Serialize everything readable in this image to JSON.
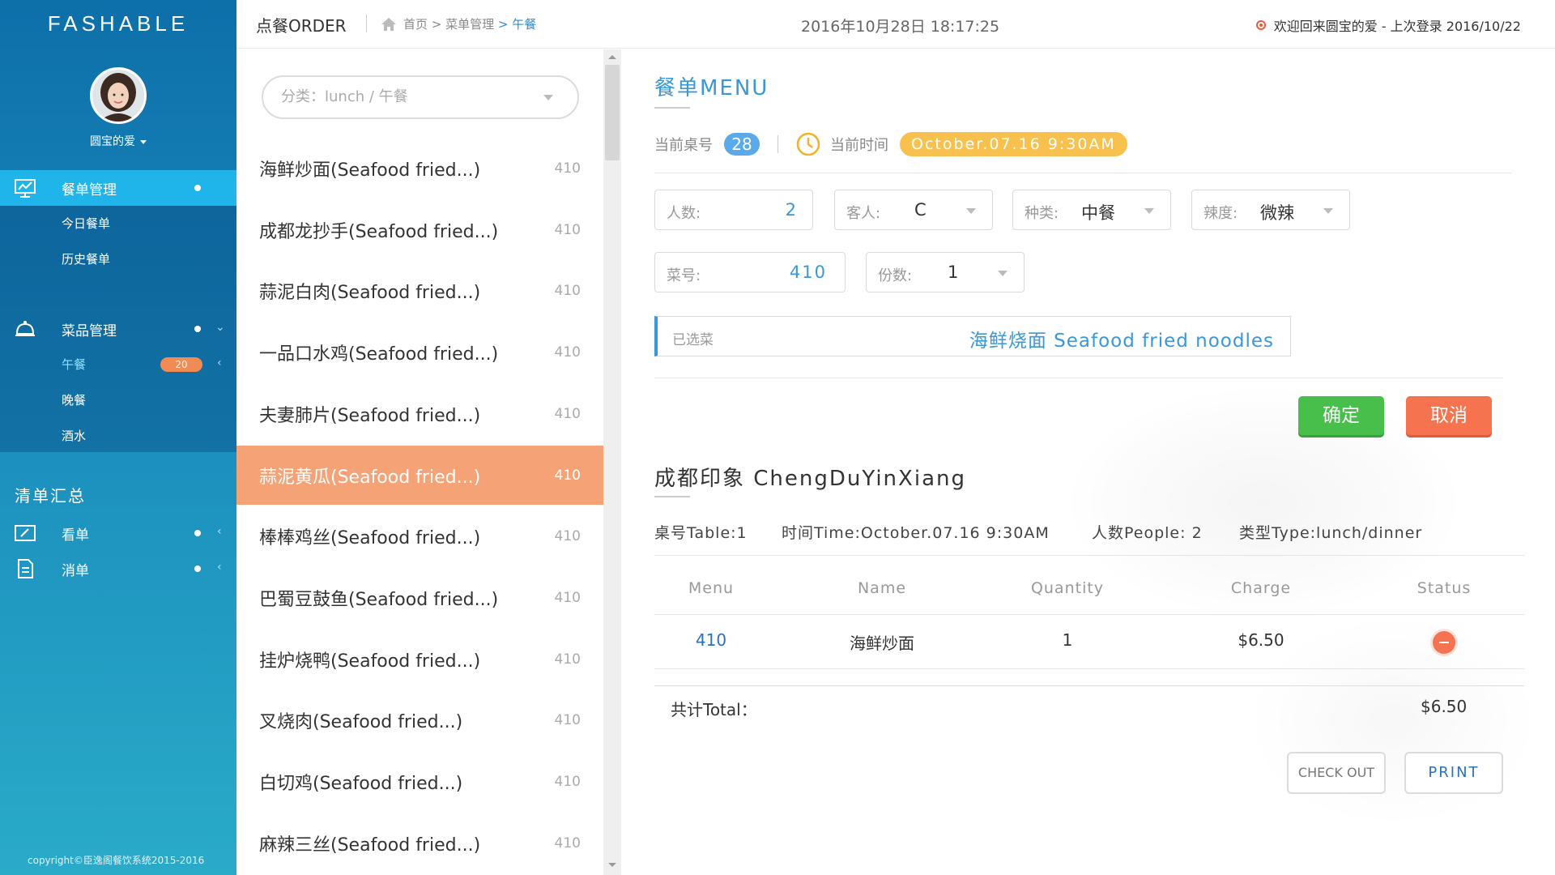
{
  "sidebar": {
    "brand": "FASHABLE",
    "user_name": "圆宝的爱",
    "groups": [
      {
        "label": "餐单管理",
        "icon": "chart-monitor-icon",
        "items": [
          "今日餐单",
          "历史餐单"
        ]
      },
      {
        "label": "菜品管理",
        "icon": "food-cloche-icon",
        "items": [
          "午餐",
          "晚餐",
          "酒水"
        ],
        "badge": "20"
      }
    ],
    "section_title": "清单汇总",
    "section_items": [
      {
        "label": "看单",
        "icon": "edit-screen-icon"
      },
      {
        "label": "消单",
        "icon": "document-icon"
      }
    ],
    "copyright": "copyright©臣逸阁餐饮系统2015-2016"
  },
  "topbar": {
    "title": "点餐ORDER",
    "breadcrumb": [
      "首页",
      "菜单管理",
      "午餐"
    ],
    "datetime": "2016年10月28日 18:17:25",
    "welcome": "欢迎回来圆宝的爱 - 上次登录 2016/10/22"
  },
  "dish_list": {
    "category_placeholder": "分类：lunch / 午餐",
    "items": [
      {
        "name": "海鲜炒面(Seafood  fried...)",
        "code": "410"
      },
      {
        "name": "成都龙抄手(Seafood  fried...)",
        "code": "410"
      },
      {
        "name": "蒜泥白肉(Seafood  fried...)",
        "code": "410"
      },
      {
        "name": "一品口水鸡(Seafood  fried...)",
        "code": "410"
      },
      {
        "name": "夫妻肺片(Seafood  fried...)",
        "code": "410"
      },
      {
        "name": "蒜泥黄瓜(Seafood  fried...)",
        "code": "410"
      },
      {
        "name": "棒棒鸡丝(Seafood  fried...)",
        "code": "410"
      },
      {
        "name": "巴蜀豆鼓鱼(Seafood  fried...)",
        "code": "410"
      },
      {
        "name": "挂炉烧鸭(Seafood  fried...)",
        "code": "410"
      },
      {
        "name": "叉烧肉(Seafood  fried...)",
        "code": "410"
      },
      {
        "name": "白切鸡(Seafood  fried...)",
        "code": "410"
      },
      {
        "name": "麻辣三丝(Seafood  fried...)",
        "code": "410"
      }
    ],
    "selected_index": 5
  },
  "order": {
    "title": "餐单MENU",
    "table_label": "当前桌号",
    "table_no": "28",
    "time_label": "当前时间",
    "time_value": "October.07.16   9:30AM",
    "fields": {
      "people": {
        "label": "人数:",
        "value": "2"
      },
      "guest": {
        "label": "客人:",
        "value": "C"
      },
      "kind": {
        "label": "种类:",
        "value": "中餐"
      },
      "spicy": {
        "label": "辣度:",
        "value": "微辣"
      },
      "dish_no": {
        "label": "菜号:",
        "value": "410"
      },
      "portions": {
        "label": "份数:",
        "value": "1"
      }
    },
    "chosen": {
      "label": "已选菜",
      "value": "海鲜烧面 Seafood fried noodles"
    },
    "confirm": "确定",
    "cancel": "取消"
  },
  "receipt": {
    "restaurant": "成都印象 ChengDuYinXiang",
    "meta": [
      "桌号Table:1",
      "时间Time:October.07.16 9:30AM",
      "人数People: 2",
      "类型Type:lunch/dinner"
    ],
    "headers": [
      "Menu",
      "Name",
      "Quantity",
      "Charge",
      "Status"
    ],
    "rows": [
      {
        "menu": "410",
        "name": "海鲜炒面",
        "quantity": "1",
        "charge": "$6.50"
      }
    ],
    "total_label": "共计Total：",
    "total_value": "$6.50",
    "checkout": "CHECK OUT",
    "print": "PRINT"
  },
  "colors": {
    "accent": "#3a97d8",
    "selected_row": "#f6a277",
    "confirm": "#48bf4b",
    "cancel": "#f5734f",
    "time_pill": "#f8c14e"
  }
}
